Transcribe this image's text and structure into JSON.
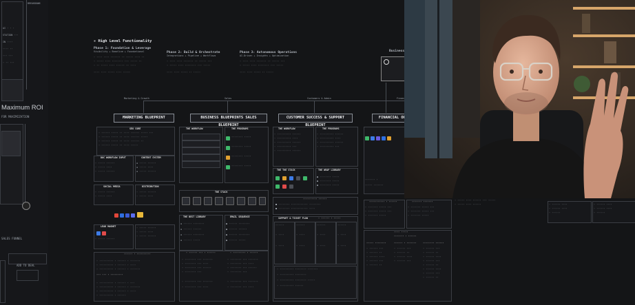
{
  "left_panel": {
    "top_label": "BREAKDOWN",
    "maximum_roi": "Maximum ROI",
    "for_labels": "FOR MAXIMIZATION",
    "sales_funnel": "SALES FUNNEL",
    "add_to_deal": "ADD TO DEAL"
  },
  "main": {
    "section_title": "High Level Functionality",
    "phase1": "Phase 1: Foundation & Leverage",
    "phase1_sub": "Visibility + Baseline + Foundational",
    "phase2": "Phase 2: Build & Orchestrate",
    "phase2_sub": "Integrations + Pipeline + Workflows",
    "phase3": "Phase 3: Autonomous Operations",
    "phase3_sub": "AI-Driven + Insights + Optimization",
    "business_label": "Business B",
    "top_labels": [
      "Marketing & Growth",
      "Sales",
      "Customers & Admin",
      "Finance"
    ],
    "blueprints": [
      "MARKETING BLUEPRINT",
      "BUSINESS BLUEPRINTS SALES BLUEPRINT",
      "CUSTOMER SUCCESS & SUPPORT BLUEPRINT",
      "FINANCIAL OPE"
    ],
    "col_headers": {
      "m1": "SEO CORE",
      "m2": "DOC WORKFLOW INPUT",
      "m3": "CONTENT SYSTEM",
      "m4": "SOCIAL MEDIA",
      "m5": "DISTRIBUTION",
      "m6": "LEAD MAGNET",
      "s1": "THE WORKFLOW",
      "s2": "THE PROGRAMS",
      "s3": "THE STACK",
      "s4": "THE BEST LIBRARY",
      "s5": "EMAIL SEQUENCE",
      "c1": "THE WORKFLOW",
      "c2": "THE PROGRAMS",
      "c3": "THE THE STACK",
      "c4": "THE WRAP LIBRARY",
      "c5": "SUPPORT & TICKET FLOW"
    }
  },
  "webcam": {
    "present": "true"
  }
}
